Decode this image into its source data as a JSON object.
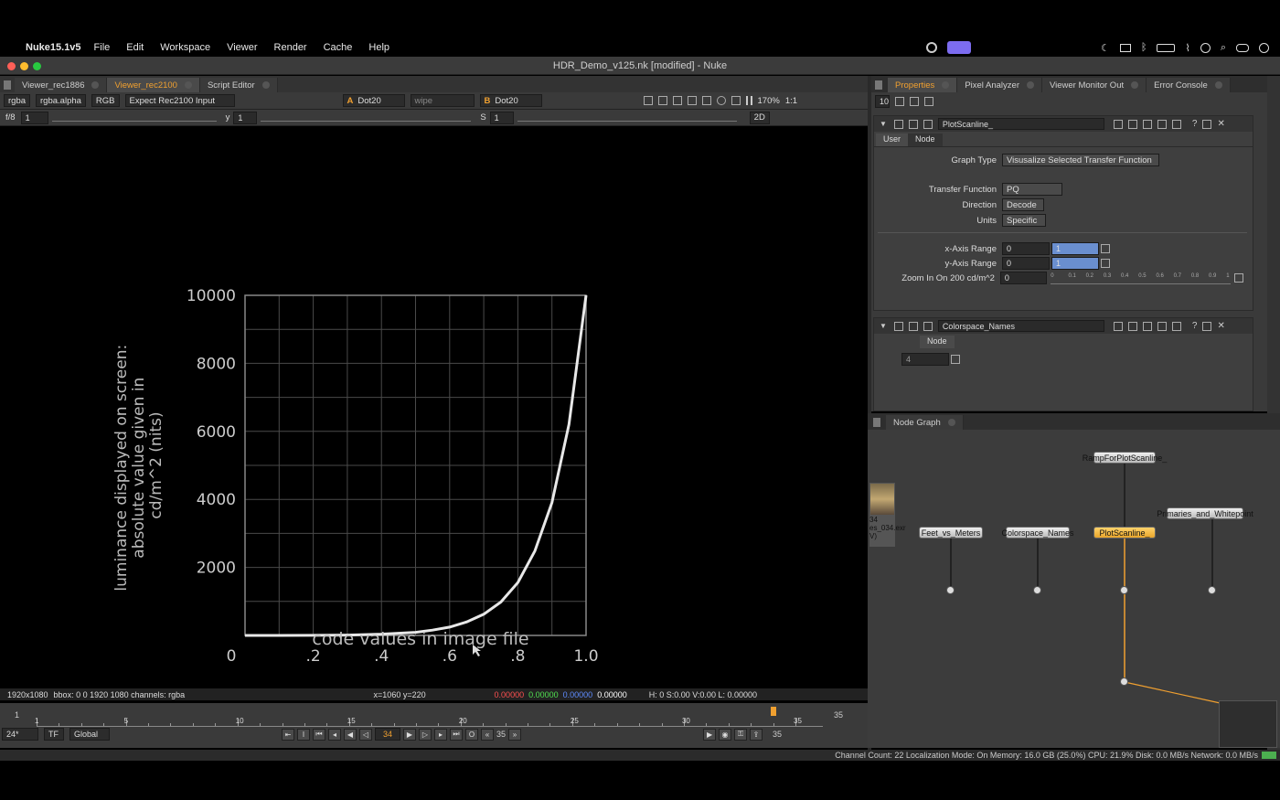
{
  "menubar": {
    "app": "Nuke15.1v5",
    "items": [
      "File",
      "Edit",
      "Workspace",
      "Viewer",
      "Render",
      "Cache",
      "Help"
    ]
  },
  "window": {
    "title": "HDR_Demo_v125.nk [modified] - Nuke"
  },
  "viewer_tabs": [
    "Viewer_rec1886",
    "Viewer_rec2100",
    "Script Editor"
  ],
  "viewer_toolbar": {
    "channels": "rgba",
    "alpha": "rgba.alpha",
    "colorspace": "RGB",
    "input_process": "Expect Rec2100 Input",
    "a_input": "Dot20",
    "wipe": "wipe",
    "b_input": "Dot20",
    "zoom": "170%",
    "ratio": "1:1"
  },
  "viewer_toolbar2": {
    "fstop": "f/8",
    "gain": "1",
    "gamma_label": "y",
    "gamma": "1",
    "s_label": "S",
    "s": "1",
    "mode": "2D"
  },
  "chart_data": {
    "type": "line",
    "xlabel": "code values in image file",
    "ylabel": "luminance displayed on screen: absolute value given in cd/m^2 (nits)",
    "x_ticks": [
      "0",
      ".2",
      ".4",
      ".6",
      ".8",
      "1.0"
    ],
    "y_ticks": [
      "10000",
      "8000",
      "6000",
      "4000",
      "2000"
    ],
    "xlim": [
      0,
      1
    ],
    "ylim": [
      0,
      10000
    ],
    "grid": true,
    "series": [
      {
        "x": [
          0,
          0.1,
          0.2,
          0.3,
          0.4,
          0.5,
          0.55,
          0.6,
          0.65,
          0.7,
          0.75,
          0.8,
          0.85,
          0.9,
          0.95,
          1.0
        ],
        "y": [
          0,
          0.3,
          2.5,
          10,
          37,
          92,
          155,
          244,
          397,
          623,
          982,
          1555,
          2482,
          3906,
          6203,
          10000
        ]
      }
    ]
  },
  "viewer_info": {
    "resolution": "1920x1080",
    "bbox": "bbox: 0 0 1920 1080 channels: rgba",
    "coords": "x=1060 y=220",
    "r": "0.00000",
    "g": "0.00000",
    "b": "0.00000",
    "a": "0.00000",
    "hsvl": "H:  0 S:0.00 V:0.00  L: 0.00000"
  },
  "timeline": {
    "start": "1",
    "ticks": [
      "1",
      "5",
      "10",
      "15",
      "20",
      "25",
      "30",
      "35"
    ],
    "current": "34",
    "end": "35",
    "fps": "24*",
    "tf": "TF",
    "scope": "Global",
    "end_field": "35",
    "out_field": "35"
  },
  "props_tabs": [
    "Properties",
    "Pixel Analyzer",
    "Viewer Monitor Out",
    "Error Console"
  ],
  "props_count": "10",
  "node1": {
    "name": "PlotScanline_",
    "tabs": [
      "User",
      "Node"
    ],
    "graph_type_label": "Graph Type",
    "graph_type": "Visusalize Selected Transfer Function",
    "tf_label": "Transfer Function",
    "tf": "PQ",
    "direction_label": "Direction",
    "direction": "Decode",
    "units_label": "Units",
    "units": "Specific",
    "xrange_label": "x-Axis Range",
    "xrange_min": "0",
    "xrange_max": "1",
    "yrange_label": "y-Axis Range",
    "yrange_min": "0",
    "yrange_max": "1",
    "zoom_label": "Zoom In On 200 cd/m^2",
    "zoom_val": "0",
    "slider_ticks": [
      "0",
      "0.1",
      "0.2",
      "0.3",
      "0.4",
      "0.5",
      "0.6",
      "0.7",
      "0.8",
      "0.9",
      "1"
    ]
  },
  "node2": {
    "name": "Colorspace_Names",
    "tab": "Node",
    "value": "4"
  },
  "node_graph": {
    "title": "Node Graph",
    "thumb_label": "34\nes_034.exr\nV)",
    "nodes": {
      "ramp": "RampForPlotScanline_",
      "feet": "Feet_vs_Meters",
      "cs": "Colorspace_Names",
      "plot": "PlotScanline_",
      "prim": "Primaries_and_Whitepoint"
    }
  },
  "status": "Channel Count: 22  Localization Mode: On  Memory: 16.0 GB (25.0%)  CPU: 21.9%  Disk: 0.0 MB/s  Network: 0.0 MB/s"
}
